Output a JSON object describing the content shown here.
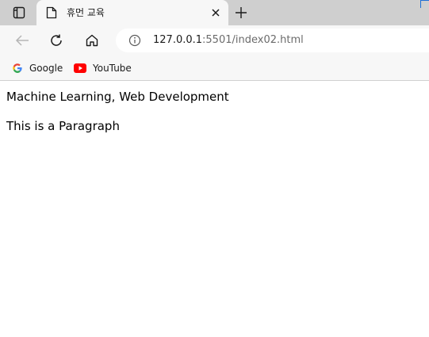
{
  "tab": {
    "title": "휴먼 교육"
  },
  "address": {
    "host": "127.0.0.1",
    "rest": ":5501/index02.html"
  },
  "bookmarks": [
    {
      "label": "Google",
      "icon": "google-icon"
    },
    {
      "label": "YouTube",
      "icon": "youtube-icon"
    }
  ],
  "page": {
    "line1": "Machine Learning, Web Development",
    "line2": "This is a Paragraph"
  },
  "colors": {
    "tabstrip": "#cfcfcf",
    "toolbar": "#f7f7f7",
    "youtube": "#ff0000",
    "accent": "#1f6fd6"
  }
}
